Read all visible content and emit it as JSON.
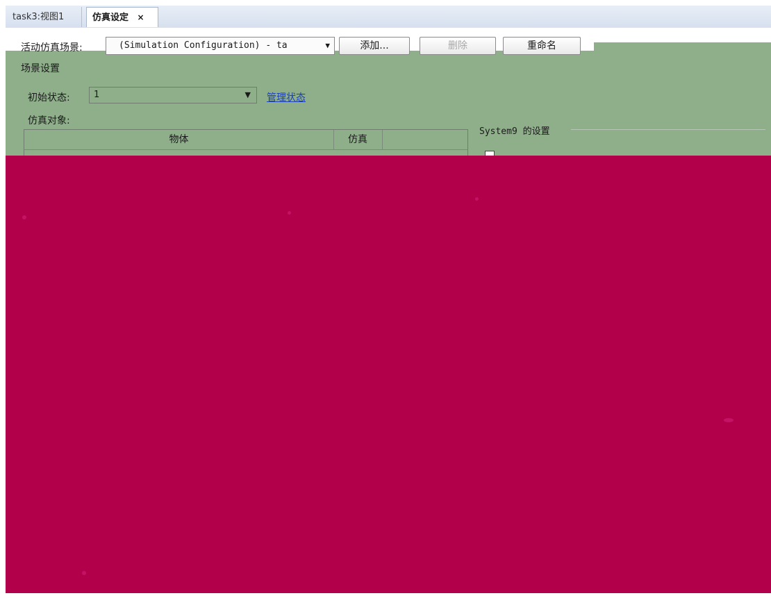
{
  "tabs": [
    {
      "label": "task3:视图1",
      "active": false
    },
    {
      "label": "仿真设定",
      "active": true,
      "close_icon": "×"
    }
  ],
  "toolbar": {
    "scene_label": "活动仿真场景:",
    "scene_value": "(Simulation Configuration) - ta",
    "add_label": "添加...",
    "delete_label": "删除",
    "rename_label": "重命名"
  },
  "scene_settings": {
    "group_title": "场景设置",
    "initial_state_label": "初始状态:",
    "initial_state_value": "1",
    "manage_states_link": "管理状态",
    "sim_objects_label": "仿真对象:",
    "columns": [
      "物体",
      "仿真"
    ]
  },
  "system_settings": {
    "title": "System9 的设置"
  },
  "colors": {
    "panel_green": "#8faf8b",
    "overlay_crimson": "#b2004b",
    "link_blue": "#1a3fb8"
  }
}
